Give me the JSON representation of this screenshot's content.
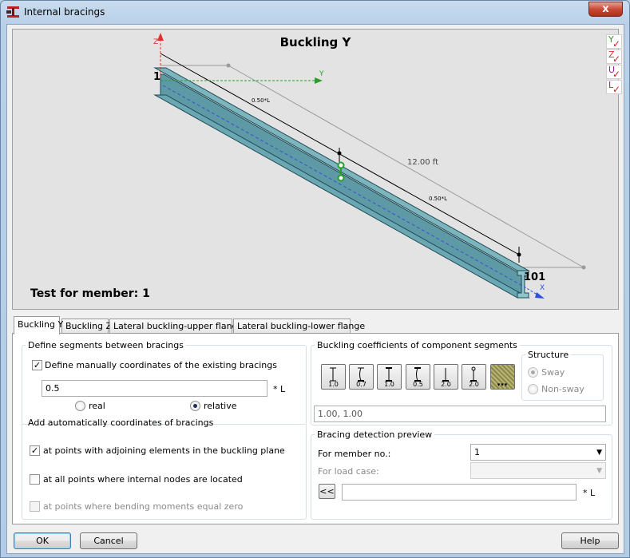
{
  "window": {
    "title": "Internal bracings",
    "close_label": "x"
  },
  "preview": {
    "title": "Buckling Y",
    "member_label": "Test for member: 1",
    "node_start": "1",
    "node_end": "101",
    "length_label": "12.00  ft",
    "seg_label_1": "0.50*L",
    "seg_label_2": "0.50*L",
    "axis_z": "Z",
    "axis_y": "Y",
    "axis_x": "X",
    "toggles": [
      "Y",
      "Z",
      "U",
      "L"
    ],
    "colors": {
      "beam": "#5e9aa6",
      "beam_dark": "#2f6470",
      "axis_z": "#e03030",
      "axis_y": "#28a028",
      "axis_x": "#3050e0"
    }
  },
  "tabs": [
    "Buckling Y",
    "Buckling Z",
    "Lateral buckling-upper flange",
    "Lateral buckling-lower flange"
  ],
  "active_tab": "Buckling Y",
  "define_segments": {
    "legend": "Define segments between bracings",
    "manual_label": "Define manually coordinates of the existing bracings",
    "manual_checked": true,
    "coords_value": "0.5",
    "coords_unit": "* L",
    "radio_real": "real",
    "radio_relative": "relative",
    "selected": "relative"
  },
  "auto_coords": {
    "legend": "Add automatically coordinates of bracings",
    "items": [
      {
        "label": "at points with adjoining elements in the buckling plane",
        "checked": true,
        "enabled": true
      },
      {
        "label": "at all points where internal nodes are located",
        "checked": false,
        "enabled": true
      },
      {
        "label": "at points where bending moments equal zero",
        "checked": false,
        "enabled": false
      }
    ]
  },
  "coefficients": {
    "legend": "Buckling coefficients of component segments",
    "buttons": [
      "1.0",
      "0.7",
      "1.0",
      "0.5",
      "2.0",
      "2.0",
      ""
    ],
    "values_text": "1.00, 1.00"
  },
  "structure": {
    "legend": "Structure",
    "sway": "Sway",
    "non_sway": "Non-sway",
    "selected": "Sway",
    "enabled": false
  },
  "detection": {
    "legend": "Bracing detection preview",
    "member_label": "For member no.:",
    "member_value": "1",
    "loadcase_label": "For load case:",
    "loadcase_value": "",
    "back_label": "<<",
    "coord_value": "",
    "coord_unit": "* L"
  },
  "footer": {
    "ok": "OK",
    "cancel": "Cancel",
    "help": "Help"
  }
}
